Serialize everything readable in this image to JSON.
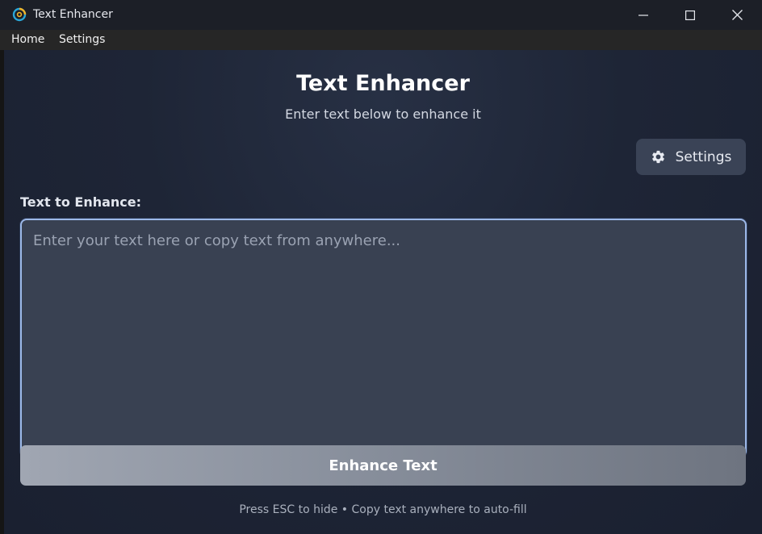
{
  "window": {
    "title": "Text Enhancer",
    "icon": "app-logo-icon"
  },
  "menu": {
    "items": [
      {
        "label": "Home"
      },
      {
        "label": "Settings"
      }
    ]
  },
  "main": {
    "title": "Text Enhancer",
    "subtitle": "Enter text below to enhance it",
    "settings_button": {
      "label": "Settings",
      "icon": "gear-icon"
    },
    "field_label": "Text to Enhance:",
    "textarea": {
      "value": "",
      "placeholder": "Enter your text here or copy text from anywhere..."
    },
    "enhance_button": {
      "label": "Enhance Text"
    },
    "footer_hint": "Press ESC to hide • Copy text anywhere to auto-fill"
  },
  "colors": {
    "background": "#1b2131",
    "textarea_bg": "#394152",
    "focus_border": "#9cb8e8",
    "button_gradient_start": "#a0a6b2",
    "button_gradient_end": "#6e7480"
  }
}
